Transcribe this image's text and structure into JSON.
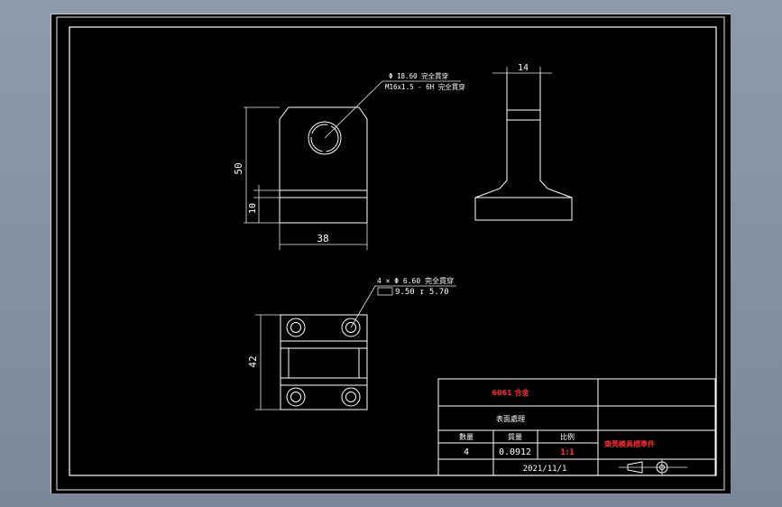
{
  "drawing": {
    "dim_front_width": "38",
    "dim_front_height": "50",
    "dim_front_small": "10",
    "dim_side_width": "14",
    "dim_top_height": "42",
    "hole_callout_line1": "Φ 18.60 完全貫穿",
    "hole_callout_line2": "M16x1.5 - 6H 完全貫穿",
    "bolt_callout_line1": "4 × Φ 6.60 完全貫穿",
    "bolt_callout_line2": "9.50 ↧ 5.70"
  },
  "title_block": {
    "material": "6061 合金",
    "finish": "表面處理",
    "qty_label": "數量",
    "weight_label": "質量",
    "scale_label": "比例",
    "qty_value": "4",
    "weight_value": "0.0912",
    "scale_value": "1:1",
    "company": "東莞模具標準件",
    "date": "2021/11/1"
  },
  "colors": {
    "background": "#000000",
    "lines": "#ffffff",
    "accent_text": "#ff2a2a"
  }
}
